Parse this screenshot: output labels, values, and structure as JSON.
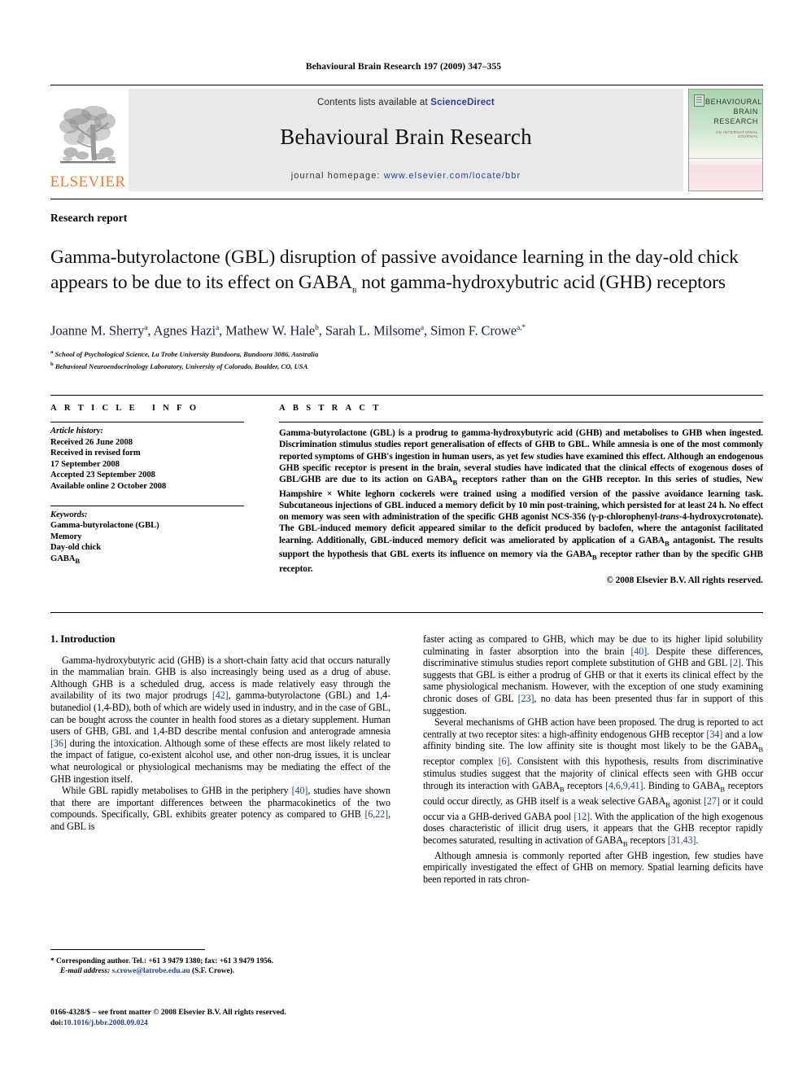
{
  "running_head": "Behavioural Brain Research 197 (2009) 347–355",
  "masthead": {
    "publisher": "ELSEVIER",
    "contents_prefix": "Contents lists available at",
    "contents_link": "ScienceDirect",
    "journal_name": "Behavioural Brain Research",
    "homepage_prefix": "journal homepage:",
    "homepage_url": "www.elsevier.com/locate/bbr",
    "cover": {
      "title_line1": "BEHAVIOURAL",
      "title_line2": "BRAIN",
      "title_line3": "RESEARCH",
      "subtitle": "AN INTERNATIONAL JOURNAL"
    }
  },
  "article": {
    "doctype": "Research report",
    "title_part1": "Gamma-butyrolactone (GBL) disruption of passive avoidance learning in the day-old chick appears to be due to its effect on GABA",
    "title_sub": "B",
    "title_part2": " not gamma-hydroxybutric acid (GHB) receptors",
    "authors": "Joanne M. Sherry",
    "authors_full": [
      {
        "name": "Joanne M. Sherry",
        "marks": "a"
      },
      {
        "name": "Agnes Hazi",
        "marks": "a"
      },
      {
        "name": "Mathew W. Hale",
        "marks": "b"
      },
      {
        "name": "Sarah L. Milsome",
        "marks": "a"
      },
      {
        "name": "Simon F. Crowe",
        "marks": "a,*"
      }
    ],
    "affiliations": [
      {
        "mark": "a",
        "text": "School of Psychological Science, La Trobe University Bundoora, Bundoora 3086, Australia"
      },
      {
        "mark": "b",
        "text": "Behavioral Neuroendocrinology Laboratory, University of Colorado, Boulder, CO, USA"
      }
    ]
  },
  "info": {
    "heading": "ARTICLE INFO",
    "history_label": "Article history:",
    "history": [
      "Received 26 June 2008",
      "Received in revised form",
      "17 September 2008",
      "Accepted 23 September 2008",
      "Available online 2 October 2008"
    ],
    "keywords_label": "Keywords:",
    "keywords": [
      "Gamma-butyrolactone (GBL)",
      "Memory",
      "Day-old chick",
      "GABA_B"
    ],
    "keyword_sub_base": "GABA",
    "keyword_sub": "B"
  },
  "abstract": {
    "heading": "ABSTRACT",
    "p1": "Gamma-butyrolactone (GBL) is a prodrug to gamma-hydroxybutyric acid (GHB) and metabolises to GHB when ingested. Discrimination stimulus studies report generalisation of effects of GHB to GBL. While amnesia is one of the most commonly reported symptoms of GHB's ingestion in human users, as yet few studies have examined this effect. Although an endogenous GHB specific receptor is present in the brain, several studies have indicated that the clinical effects of exogenous doses of GBL/GHB are due to its action on GABA",
    "p1b": " receptors rather than on the GHB receptor. In this series of studies, New Hampshire × White leghorn cockerels were trained using a modified version of the passive avoidance learning task. Subcutaneous injections of GBL induced a memory deficit by 10 min post-training, which persisted for at least 24 h. No effect on memory was seen with administration of the specific GHB agonist NCS-356 (γ-p-chlorophenyl-",
    "p1_italic": "trans",
    "p1c": "-4-hydroxycrotonate). The GBL-induced memory deficit appeared similar to the deficit produced by baclofen, where the antagonist facilitated learning. Additionally, GBL-induced memory deficit was ameliorated by application of a GABA",
    "p1d": " antagonist. The results support the hypothesis that GBL exerts its influence on memory via the GABA",
    "p1e": " receptor rather than by the specific GHB receptor.",
    "copyright": "© 2008 Elsevier B.V. All rights reserved."
  },
  "body": {
    "section_number_title": "1. Introduction",
    "left": {
      "para1_a": "Gamma-hydroxybutyric acid (GHB) is a short-chain fatty acid that occurs naturally in the mammalian brain. GHB is also increasingly being used as a drug of abuse. Although GHB is a scheduled drug, access is made relatively easy through the availability of its two major prodrugs ",
      "para1_ref1": "[42]",
      "para1_b": ", gamma-butyrolactone (GBL) and 1,4-butanediol (1,4-BD), both of which are widely used in industry, and in the case of GBL, can be bought across the counter in health food stores as a dietary supplement. Human users of GHB, GBL and 1,4-BD describe mental confusion and anterograde amnesia ",
      "para1_ref2": "[36]",
      "para1_c": " during the intoxication. Although some of these effects are most likely related to the impact of fatigue, co-existent alcohol use, and other non-drug issues, it is unclear what neurological or physiological mechanisms may be mediating the effect of the GHB ingestion itself.",
      "para2_a": "While GBL rapidly metabolises to GHB in the periphery ",
      "para2_ref1": "[40]",
      "para2_b": ", studies have shown that there are important differences between the pharmacokinetics of the two compounds. Specifically, GBL exhibits greater potency as compared to GHB ",
      "para2_ref2": "[6,22]",
      "para2_c": ", and GBL is"
    },
    "right": {
      "para2_cont_a": "faster acting as compared to GHB, which may be due to its higher lipid solubility culminating in faster absorption into the brain ",
      "para2_cont_ref1": "[40]",
      "para2_cont_b": ". Despite these differences, discriminative stimulus studies report complete substitution of GHB and GBL ",
      "para2_cont_ref2": "[2]",
      "para2_cont_c": ". This suggests that GBL is either a prodrug of GHB or that it exerts its clinical effect by the same physiological mechanism. However, with the exception of one study examining chronic doses of GBL ",
      "para2_cont_ref3": "[23]",
      "para2_cont_d": ", no data has been presented thus far in support of this suggestion.",
      "para3_a": "Several mechanisms of GHB action have been proposed. The drug is reported to act centrally at two receptor sites: a high-affinity endogenous GHB receptor ",
      "para3_ref1": "[34]",
      "para3_b": " and a low affinity binding site. The low affinity site is thought most likely to be the GABA",
      "para3_c": " receptor complex ",
      "para3_ref2": "[6]",
      "para3_d": ". Consistent with this hypothesis, results from discriminative stimulus studies suggest that the majority of clinical effects seen with GHB occur through its interaction with GABA",
      "para3_e": " receptors ",
      "para3_ref3": "[4,6,9,41]",
      "para3_f": ". Binding to GABA",
      "para3_g": " receptors could occur directly, as GHB itself is a weak selective GABA",
      "para3_h": " agonist ",
      "para3_ref4": "[27]",
      "para3_i": " or it could occur via a GHB-derived GABA pool ",
      "para3_ref5": "[12]",
      "para3_j": ". With the application of the high exogenous doses characteristic of illicit drug users, it appears that the GHB receptor rapidly becomes saturated, resulting in activation of GABA",
      "para3_k": " receptors ",
      "para3_ref6": "[31,43]",
      "para3_l": ".",
      "para4": "Although amnesia is commonly reported after GHB ingestion, few studies have empirically investigated the effect of GHB on memory. Spatial learning deficits have been reported in rats chron-"
    }
  },
  "footnotes": {
    "star": "*",
    "corresponding": "Corresponding author. Tel.: +61 3 9479 1380; fax: +61 3 9479 1956.",
    "email_label": "E-mail address:",
    "email": "s.crowe@latrobe.edu.au",
    "email_owner": "(S.F. Crowe).",
    "issn_line": "0166-4328/$ – see front matter © 2008 Elsevier B.V. All rights reserved.",
    "doi_label": "doi:",
    "doi": "10.1016/j.bbr.2008.09.024"
  },
  "colors": {
    "elsevier_orange": "#F47B20",
    "link_blue": "#2A3F9D",
    "reference_blue": "#243E8C",
    "band_gray": "#e9e9e9"
  }
}
